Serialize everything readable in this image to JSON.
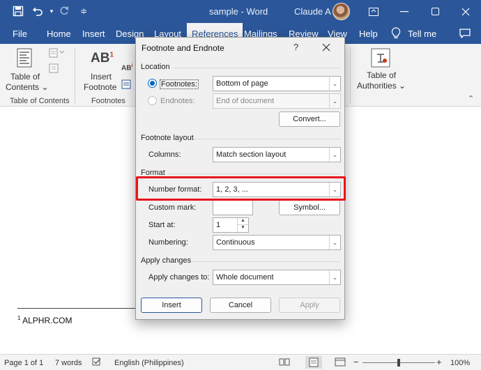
{
  "titlebar": {
    "doc_title": "sample  -  Word",
    "user_name": "Claude A"
  },
  "menu": {
    "items": [
      "File",
      "Home",
      "Insert",
      "Design",
      "Layout",
      "References",
      "Mailings",
      "Review",
      "View",
      "Help"
    ],
    "active": "References",
    "tell_me": "Tell me"
  },
  "ribbon": {
    "toc_label_1": "Table of",
    "toc_label_2": "Contents",
    "toc_group": "Table of Contents",
    "insert_fn_1": "Insert",
    "insert_fn_2": "Footnote",
    "footnotes_group": "Footnotes",
    "toa_label_1": "Table of",
    "toa_label_2": "Authorities",
    "ab_glyph": "AB",
    "ab_sup": "1"
  },
  "document": {
    "footnote_number": "1",
    "footnote_text": "ALPHR.COM"
  },
  "statusbar": {
    "page": "Page 1 of 1",
    "words": "7 words",
    "language": "English (Philippines)",
    "zoom": "100%"
  },
  "dialog": {
    "title": "Footnote and Endnote",
    "help": "?",
    "location_section": "Location",
    "footnotes_label": "Footnotes:",
    "footnotes_value": "Bottom of page",
    "endnotes_label": "Endnotes:",
    "endnotes_value": "End of document",
    "convert_button": "Convert...",
    "layout_section": "Footnote layout",
    "columns_label": "Columns:",
    "columns_value": "Match section layout",
    "format_section": "Format",
    "number_format_label": "Number format:",
    "number_format_value": "1, 2, 3, ...",
    "custom_mark_label": "Custom mark:",
    "custom_mark_value": "",
    "symbol_button": "Symbol...",
    "start_at_label": "Start at:",
    "start_at_value": "1",
    "numbering_label": "Numbering:",
    "numbering_value": "Continuous",
    "apply_section": "Apply changes",
    "apply_to_label": "Apply changes to:",
    "apply_to_value": "Whole document",
    "insert_button": "Insert",
    "cancel_button": "Cancel",
    "apply_button": "Apply"
  },
  "colors": {
    "word_blue": "#2b579a",
    "highlight_red": "#e8141b",
    "radio_blue": "#0067c0"
  }
}
